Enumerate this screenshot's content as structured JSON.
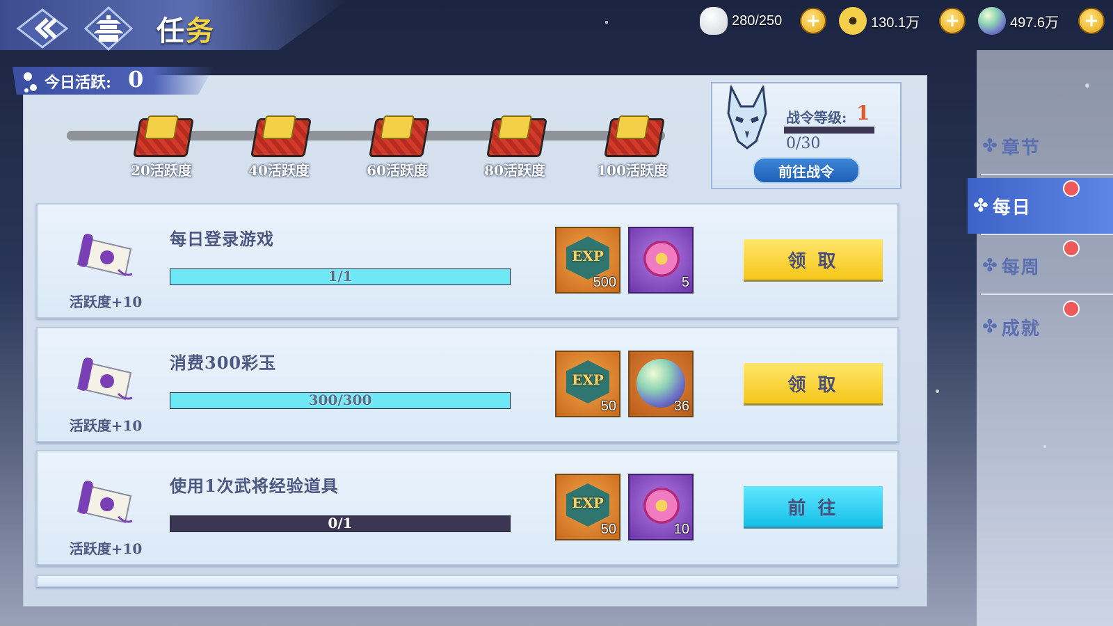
{
  "header": {
    "title_main": "任",
    "title_accent": "务"
  },
  "resources": [
    {
      "name": "stamina",
      "value": "280/250",
      "icon": "rice-ball-icon",
      "color": "#e8e8e8"
    },
    {
      "name": "coins",
      "value": "130.1万",
      "icon": "coin-icon",
      "color": "#e6b42a"
    },
    {
      "name": "jade",
      "value": "497.6万",
      "icon": "jade-orb-icon",
      "color": "#7bc9a6"
    }
  ],
  "activity": {
    "label": "今日活跃:",
    "value": "0",
    "chests": [
      {
        "label": "20活跃度"
      },
      {
        "label": "40活跃度"
      },
      {
        "label": "60活跃度"
      },
      {
        "label": "80活跃度"
      },
      {
        "label": "100活跃度"
      }
    ]
  },
  "battle_pass": {
    "level_label": "战令等级:",
    "level": "1",
    "progress": "0/30",
    "progress_fraction": 0,
    "button": "前往战令"
  },
  "tasks": [
    {
      "activity_reward": "活跃度+10",
      "name": "每日登录游戏",
      "progress_text": "1/1",
      "progress_fraction": 1,
      "rewards": [
        {
          "type": "exp",
          "label": "EXP",
          "qty": "500"
        },
        {
          "type": "flower",
          "qty": "5"
        }
      ],
      "action": "领 取",
      "action_type": "claim"
    },
    {
      "activity_reward": "活跃度+10",
      "name": "消费300彩玉",
      "progress_text": "300/300",
      "progress_fraction": 1,
      "rewards": [
        {
          "type": "exp",
          "label": "EXP",
          "qty": "50"
        },
        {
          "type": "orb",
          "qty": "36"
        }
      ],
      "action": "领 取",
      "action_type": "claim"
    },
    {
      "activity_reward": "活跃度+10",
      "name": "使用1次武将经验道具",
      "progress_text": "0/1",
      "progress_fraction": 0,
      "rewards": [
        {
          "type": "exp",
          "label": "EXP",
          "qty": "50"
        },
        {
          "type": "flower",
          "qty": "10"
        }
      ],
      "action": "前 往",
      "action_type": "go"
    }
  ],
  "sidenav": [
    {
      "label": "章节",
      "active": false,
      "badge": false
    },
    {
      "label": "每日",
      "active": true,
      "badge": true
    },
    {
      "label": "每周",
      "active": false,
      "badge": true
    },
    {
      "label": "成就",
      "active": false,
      "badge": true
    }
  ],
  "colors": {
    "accent_yellow": "#f5c71a",
    "accent_cyan": "#16bfe9",
    "nav_active": "#3e63c8",
    "progress_fill": "#6fe8f6",
    "badge_red": "#ee5a5a"
  }
}
